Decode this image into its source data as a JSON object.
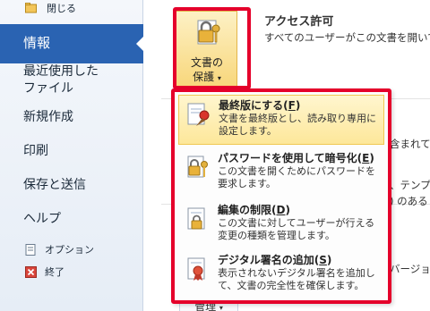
{
  "nav": {
    "close": "閉じる",
    "info": "情報",
    "recent": [
      "最近使用した",
      "ファイル"
    ],
    "new": "新規作成",
    "print": "印刷",
    "save_send": "保存と送信",
    "help": "ヘルプ",
    "options": "オプション",
    "exit": "終了"
  },
  "protect": {
    "button_line1": "文書の",
    "button_line2": "保護",
    "title": "アクセス許可",
    "description": "すべてのユーザーがこの文書を開いて"
  },
  "background": {
    "t1": "含まれて",
    "t2": "、テンプ",
    "t3": ") のある",
    "t4": "バージョン",
    "manage": "管理"
  },
  "menu": {
    "items": [
      {
        "title": "最終版にする(",
        "key": "F",
        "close": ")",
        "desc": "文書を最終版とし、読み取り専用に設定します。"
      },
      {
        "title": "パスワードを使用して暗号化(",
        "key": "E",
        "close": ")",
        "desc": "この文書を開くためにパスワードを要求します。"
      },
      {
        "title": "編集の制限(",
        "key": "D",
        "close": ")",
        "desc": "この文書に対してユーザーが行える変更の種類を管理します。"
      },
      {
        "title": "デジタル署名の追加(",
        "key": "S",
        "close": ")",
        "desc": "表示されないデジタル署名を追加して、文書の完全性を確保します。"
      }
    ]
  },
  "colors": {
    "accent": "#2a63b2",
    "highlight_frame": "#e5002b",
    "hover": "#fde79a"
  }
}
